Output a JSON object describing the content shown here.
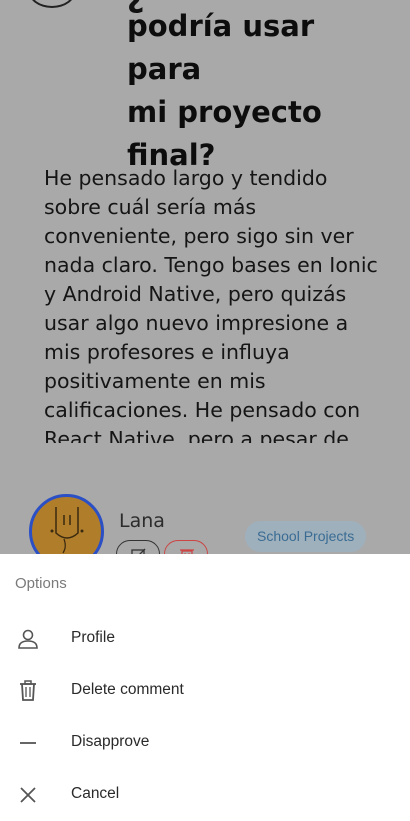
{
  "post": {
    "title_lines": [
      "podría usar para",
      "mi proyecto",
      "final?"
    ],
    "body": "He pensado largo y tendido sobre cuál sería más conveniente, pero sigo sin ver nada claro. Tengo bases en Ionic y Android Native, pero quizás usar algo nuevo impresione a mis profesores e influya positivamente en mis calificaciones. He pensado con React Native, pero a pesar de",
    "author": "Lana",
    "tag": "School Projects"
  },
  "sheet": {
    "header": "Options",
    "options": [
      {
        "label": "Profile",
        "icon": "person-icon"
      },
      {
        "label": "Delete comment",
        "icon": "trash-icon"
      },
      {
        "label": "Disapprove",
        "icon": "minus-icon"
      },
      {
        "label": "Cancel",
        "icon": "close-icon"
      }
    ]
  },
  "colors": {
    "overlay_background": "#a9a9a9",
    "sheet_background": "#ffffff",
    "avatar_ring": "#2b4fc4",
    "avatar_fill": "#b07d2a",
    "tag_text": "#3a6c93",
    "delete_accent": "#cc4444"
  }
}
